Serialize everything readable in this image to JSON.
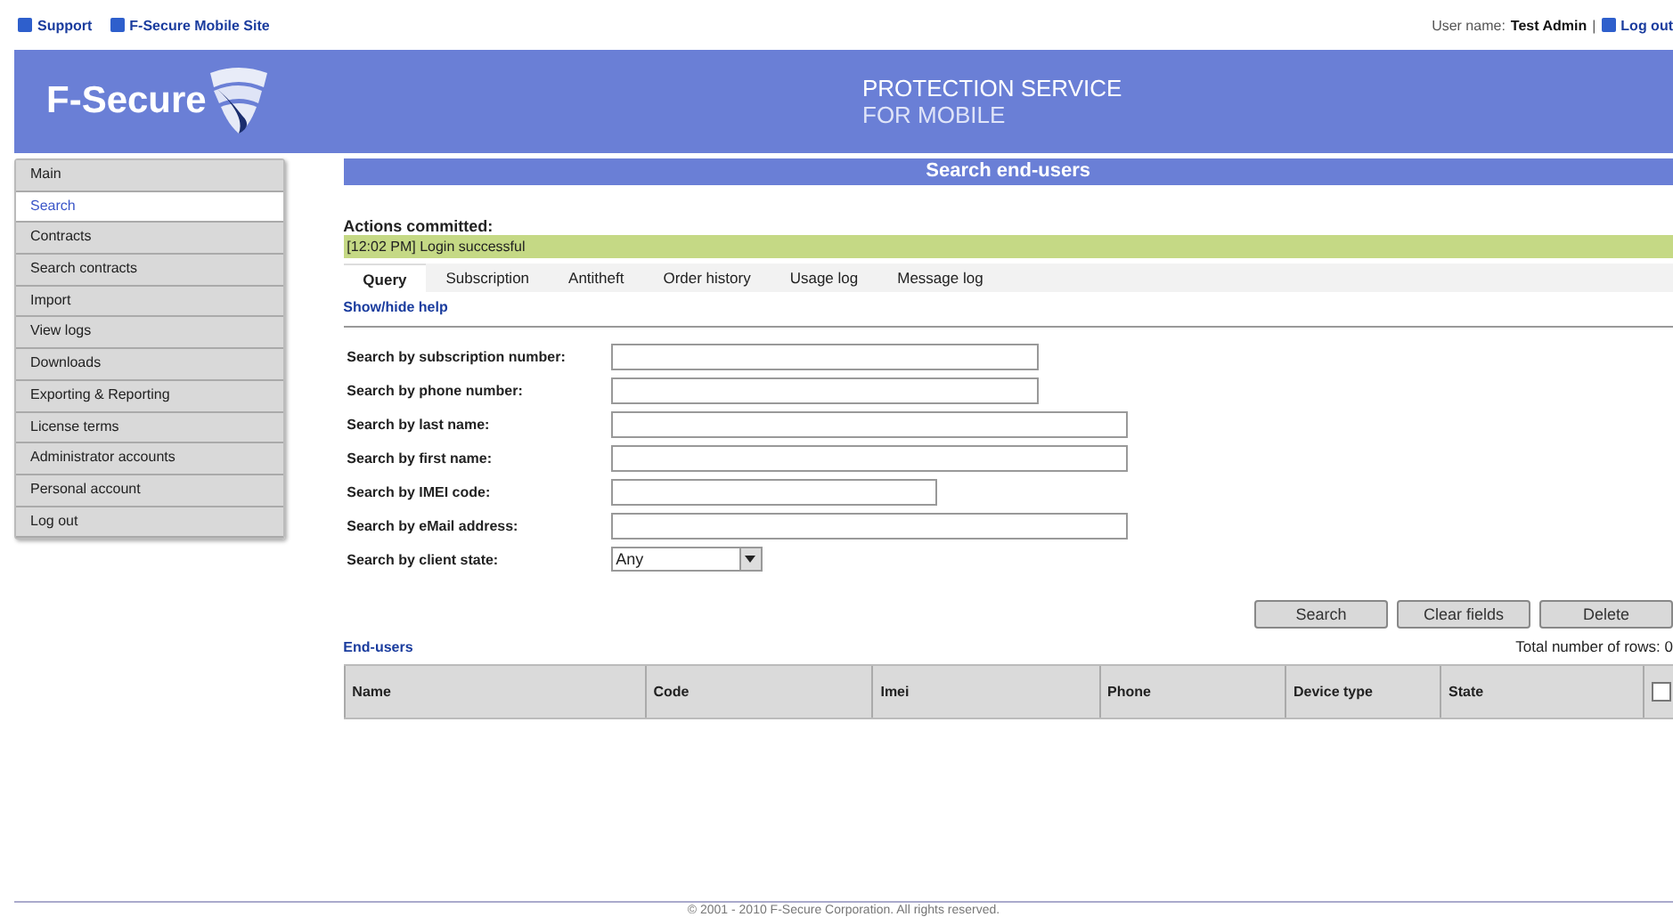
{
  "top_links": [
    {
      "label": "Support"
    },
    {
      "label": "F-Secure Mobile Site"
    }
  ],
  "user": {
    "prefix": "User name:",
    "name": "Test Admin",
    "separator": "|",
    "logout": "Log out"
  },
  "header": {
    "logo": "F-Secure",
    "product_line1": "PROTECTION SERVICE",
    "product_line2": "FOR MOBILE"
  },
  "sidebar": {
    "items": [
      {
        "label": "Main",
        "selected": false
      },
      {
        "label": "Search",
        "selected": true
      },
      {
        "label": "Contracts",
        "selected": false
      },
      {
        "label": "Search contracts",
        "selected": false
      },
      {
        "label": "Import",
        "selected": false
      },
      {
        "label": "View logs",
        "selected": false
      },
      {
        "label": "Downloads",
        "selected": false
      },
      {
        "label": "Exporting & Reporting",
        "selected": false
      },
      {
        "label": "License terms",
        "selected": false
      },
      {
        "label": "Administrator accounts",
        "selected": false
      },
      {
        "label": "Personal account",
        "selected": false
      },
      {
        "label": "Log out",
        "selected": false
      }
    ]
  },
  "page_title": "Search end-users",
  "actions": {
    "heading": "Actions committed:",
    "message": "[12:02 PM] Login successful"
  },
  "tabs": [
    {
      "label": "Query",
      "selected": true
    },
    {
      "label": "Subscription",
      "selected": false
    },
    {
      "label": "Antitheft",
      "selected": false
    },
    {
      "label": "Order history",
      "selected": false
    },
    {
      "label": "Usage log",
      "selected": false
    },
    {
      "label": "Message log",
      "selected": false
    }
  ],
  "help_link": "Show/hide help",
  "form": [
    {
      "kind": "text",
      "label": "Search by subscription number:"
    },
    {
      "kind": "text",
      "label": "Search by phone number:"
    },
    {
      "kind": "text",
      "label": "Search by last name:"
    },
    {
      "kind": "text",
      "label": "Search by first name:"
    },
    {
      "kind": "text",
      "label": "Search by IMEI code:"
    },
    {
      "kind": "text",
      "label": "Search by eMail address:"
    },
    {
      "kind": "select",
      "label": "Search by client state:",
      "value": "Any"
    }
  ],
  "buttons": [
    "Search",
    "Clear fields",
    "Delete"
  ],
  "results": {
    "heading": "End-users",
    "total": "Total number of rows: 0",
    "columns": [
      "Name",
      "Code",
      "Imei",
      "Phone",
      "Device type",
      "State"
    ],
    "select_all_checked": false
  },
  "footer": "© 2001 - 2010 F-Secure Corporation. All rights reserved."
}
